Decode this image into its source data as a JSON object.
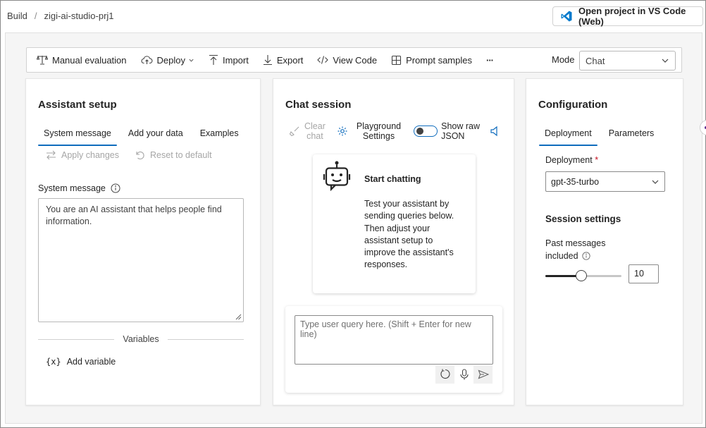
{
  "breadcrumb": {
    "root": "Build",
    "separator": "/",
    "project": "zigi-ai-studio-prj1"
  },
  "vscode_button": {
    "label": "Open project in VS Code (Web)"
  },
  "toolbar": {
    "manual_eval": "Manual evaluation",
    "deploy": "Deploy",
    "import": "Import",
    "export": "Export",
    "view_code": "View Code",
    "prompt_samples": "Prompt samples",
    "more": "···",
    "mode_label": "Mode",
    "mode_value": "Chat"
  },
  "assistant": {
    "title": "Assistant setup",
    "tabs": [
      "System message",
      "Add your data",
      "Examples"
    ],
    "apply_changes": "Apply changes",
    "reset_default": "Reset to default",
    "system_label": "System message",
    "system_text": "You are an AI assistant that helps people find information.",
    "variables_label": "Variables",
    "add_variable_icon_text": "{x}",
    "add_variable": "Add variable"
  },
  "chat": {
    "title": "Chat session",
    "clear_chat_1": "Clear",
    "clear_chat_2": "chat",
    "playground_1": "Playground",
    "playground_2": "Settings",
    "show_raw_1": "Show raw",
    "show_raw_2": "JSON",
    "card_title": "Start chatting",
    "card_desc": "Test your assistant by sending queries below. Then adjust your assistant setup to improve the assistant's responses.",
    "input_placeholder": "Type user query here. (Shift + Enter for new line)"
  },
  "config": {
    "title": "Configuration",
    "tabs": [
      "Deployment",
      "Parameters"
    ],
    "deployment_label": "Deployment",
    "required_mark": "*",
    "deployment_value": "gpt-35-turbo",
    "session_title": "Session settings",
    "past_messages_1": "Past messages",
    "past_messages_2": "included",
    "past_messages_value": "10",
    "past_messages_slider_fraction": 0.47
  },
  "colors": {
    "accent": "#0f6cbd",
    "required": "#c50f1f",
    "vscode_blue": "#007acc"
  }
}
